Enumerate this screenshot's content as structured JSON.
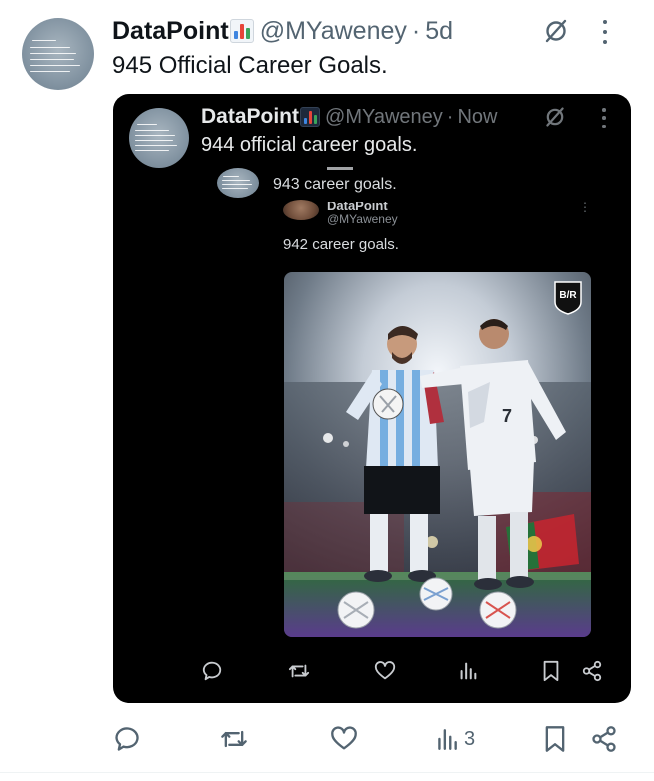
{
  "tweet": {
    "author_name": "DataPoint",
    "author_handle": "@MYaweney",
    "separator": "·",
    "time": "5d",
    "text": "945 Official Career Goals.",
    "actions": {
      "reply_icon": "reply-icon",
      "retweet_icon": "retweet-icon",
      "like_icon": "heart-icon",
      "views_icon": "views-icon",
      "views_count": "3",
      "bookmark_icon": "bookmark-icon",
      "share_icon": "share-icon"
    }
  },
  "quoted": {
    "author_name": "DataPoint",
    "author_handle": "@MYaweney",
    "separator": "·",
    "time": "Now",
    "text": "944 official career goals.",
    "nested": {
      "text": "943 career goals.",
      "inner_name": "DataPoint",
      "inner_handle": "@MYaweney",
      "inner_text": "942 career goals.",
      "more": "⋮"
    },
    "image_logo": "B/R"
  },
  "colors": {
    "accent_dark": "#e7e9ea",
    "muted": "#536471",
    "embed_bg": "#000000"
  }
}
